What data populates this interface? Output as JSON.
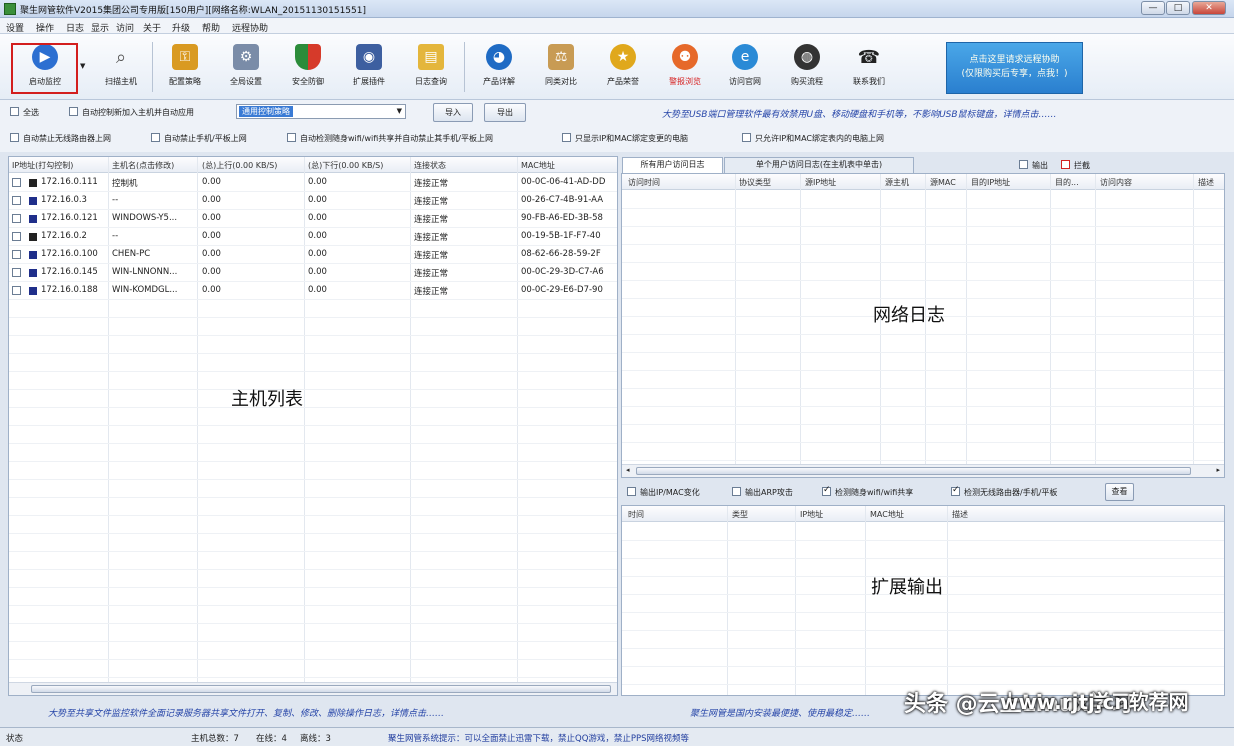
{
  "window": {
    "title": "聚生网管软件V2015集团公司专用版[150用户][网络名称:WLAN_20151130151551]"
  },
  "menu": [
    "设置",
    "操作",
    "日志",
    "显示",
    "访问",
    "关于",
    "升级",
    "帮助",
    "远程协助"
  ],
  "toolbar": {
    "start_monitor": "启动监控",
    "scan_host": "扫描主机",
    "config_policy": "配置策略",
    "global_settings": "全局设置",
    "security_defense": "安全防御",
    "extend_plugin": "扩展插件",
    "log_query": "日志查询",
    "product_details": "产品详解",
    "compare_products": "同类对比",
    "product_honor": "产品荣誉",
    "alert_view": "警报浏览",
    "visit_website": "访问官网",
    "purchase_process": "购买流程",
    "contact_us": "联系我们",
    "promo_line1": "点击这里请求远程协助",
    "promo_line2": "(仅限购买后专享，点我！)"
  },
  "options": {
    "select_all": "全选",
    "auto_control_new": "自动控制新加入主机并自动应用",
    "policy_value": "通用控制策略",
    "import": "导入",
    "export": "导出",
    "notice_top": "大势至USB端口管理软件最有效禁用U盘、移动硬盘和手机等，不影响USB鼠标键盘，详情点击……",
    "opt1": "自动禁止无线路由器上网",
    "opt2": "自动禁止手机/平板上网",
    "opt3": "自动检测随身wifi/wifi共享并自动禁止其手机/平板上网",
    "opt4": "只显示IP和MAC绑定变更的电脑",
    "opt5": "只允许IP和MAC绑定表内的电脑上网"
  },
  "host_table": {
    "headers": [
      "IP地址(打勾控制)",
      "主机名(点击修改)",
      "(总)上行(0.00 KB/S)",
      "(总)下行(0.00 KB/S)",
      "连接状态",
      "MAC地址"
    ],
    "rows": [
      {
        "ip": "172.16.0.111",
        "name": "控制机",
        "up": "0.00",
        "down": "0.00",
        "status": "连接正常",
        "mac": "00-0C-06-41-AD-DD"
      },
      {
        "ip": "172.16.0.3",
        "name": "--",
        "up": "0.00",
        "down": "0.00",
        "status": "连接正常",
        "mac": "00-26-C7-4B-91-AA"
      },
      {
        "ip": "172.16.0.121",
        "name": "WINDOWS-Y5...",
        "up": "0.00",
        "down": "0.00",
        "status": "连接正常",
        "mac": "90-FB-A6-ED-3B-58"
      },
      {
        "ip": "172.16.0.2",
        "name": "--",
        "up": "0.00",
        "down": "0.00",
        "status": "连接正常",
        "mac": "00-19-5B-1F-F7-40"
      },
      {
        "ip": "172.16.0.100",
        "name": "CHEN-PC",
        "up": "0.00",
        "down": "0.00",
        "status": "连接正常",
        "mac": "08-62-66-28-59-2F"
      },
      {
        "ip": "172.16.0.145",
        "name": "WIN-LNNONN...",
        "up": "0.00",
        "down": "0.00",
        "status": "连接正常",
        "mac": "00-0C-29-3D-C7-A6"
      },
      {
        "ip": "172.16.0.188",
        "name": "WIN-KOMDGL...",
        "up": "0.00",
        "down": "0.00",
        "status": "连接正常",
        "mac": "00-0C-29-E6-D7-90"
      }
    ],
    "overlay_label": "主机列表"
  },
  "log_panel": {
    "tabs": [
      "所有用户访问日志",
      "单个用户访问日志(在主机表中单击)"
    ],
    "output_label": "输出",
    "intercept_label": "拦截",
    "headers": [
      "访问时间",
      "协议类型",
      "源IP地址",
      "源主机",
      "源MAC",
      "目的IP地址",
      "目的...",
      "访问内容",
      "描述"
    ],
    "overlay_label": "网络日志"
  },
  "ext_panel": {
    "opt1": "输出IP/MAC变化",
    "opt2": "输出ARP攻击",
    "opt3": "检测随身wifi/wifi共享",
    "opt4": "检测无线路由器/手机/平板",
    "view": "查看",
    "headers": [
      "时间",
      "类型",
      "IP地址",
      "MAC地址",
      "描述"
    ],
    "overlay_label": "扩展输出"
  },
  "bottom_notices": {
    "left": "大势至共享文件监控软件全面记录服务器共享文件打开、复制、修改、删除操作日志，详情点击……",
    "right": "聚生网管是国内安装最便捷、使用最稳定……"
  },
  "status": {
    "label": "状态",
    "total_label": "主机总数：7",
    "online_label": "在线：4",
    "offline_label": "离线：3",
    "marquee": "聚生网管系统提示：可以全面禁止迅雷下载，禁止QQ游戏，禁止PPS网络视频等"
  },
  "watermark": "头条 @云上Linux学习",
  "watermark2": "www.rjtj.cn软荐网"
}
